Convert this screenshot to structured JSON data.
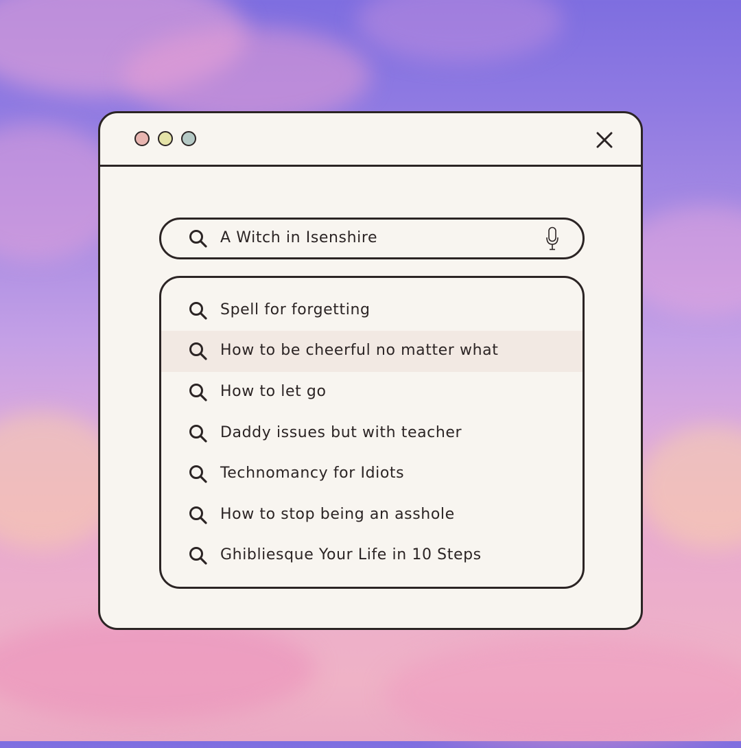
{
  "window": {
    "controls": [
      {
        "name": "red",
        "color": "#e8b5b0"
      },
      {
        "name": "yellow",
        "color": "#e5e3a8"
      },
      {
        "name": "green",
        "color": "#b5c9c5"
      }
    ],
    "close_icon": "close-icon"
  },
  "search": {
    "icon": "search-icon",
    "value": "A Witch in Isenshire",
    "mic_icon": "microphone-icon"
  },
  "suggestions": {
    "highlight_color": "#f2e9e3",
    "items": [
      {
        "label": "Spell for forgetting",
        "icon": "search-icon",
        "highlighted": false
      },
      {
        "label": "How to be cheerful no matter what",
        "icon": "search-icon",
        "highlighted": true
      },
      {
        "label": "How to let go",
        "icon": "search-icon",
        "highlighted": false
      },
      {
        "label": "Daddy issues but with teacher",
        "icon": "search-icon",
        "highlighted": false
      },
      {
        "label": "Technomancy for Idiots",
        "icon": "search-icon",
        "highlighted": false
      },
      {
        "label": "How to stop being an asshole",
        "icon": "search-icon",
        "highlighted": false
      },
      {
        "label": "Ghibliesque Your Life in 10 Steps",
        "icon": "search-icon",
        "highlighted": false
      }
    ]
  },
  "colors": {
    "frame": "#2b2424",
    "panel": "#f8f5f0"
  }
}
